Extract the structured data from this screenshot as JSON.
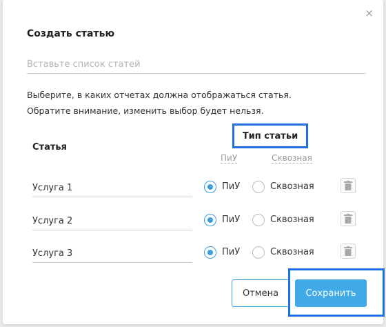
{
  "modal": {
    "title": "Создать статью",
    "close_symbol": "×",
    "paste_placeholder": "Вставьте список статей",
    "hint_line1": "Выберите, в каких отчетах должна отображаться статья.",
    "hint_line2": "Обратите внимание, изменить выбор будет нельзя."
  },
  "table": {
    "col_article": "Статья",
    "col_type": "Тип статьи",
    "type_option_piu": "ПиУ",
    "type_option_skv": "Сквозная",
    "rows": [
      {
        "name": "Услуга 1",
        "piu_label": "ПиУ",
        "skv_label": "Сквозная",
        "selected": "ПиУ"
      },
      {
        "name": "Услуга 2",
        "piu_label": "ПиУ",
        "skv_label": "Сквозная",
        "selected": "ПиУ"
      },
      {
        "name": "Услуга 3",
        "piu_label": "ПиУ",
        "skv_label": "Сквозная",
        "selected": "ПиУ"
      }
    ]
  },
  "buttons": {
    "cancel": "Отмена",
    "save": "Сохранить"
  },
  "colors": {
    "accent": "#41a9e6",
    "highlight_frame": "#1e6fe0"
  },
  "icons": {
    "close": "close-icon",
    "trash": "trash-icon"
  }
}
